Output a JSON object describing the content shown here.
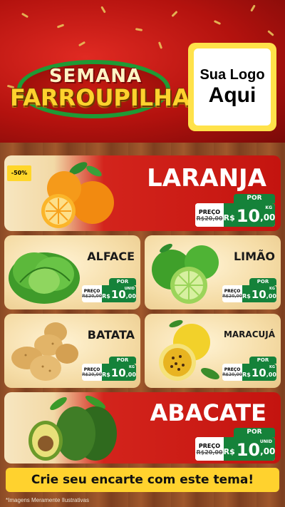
{
  "header": {
    "title_line1": "SEMANA",
    "title_line2": "FARROUPILHA",
    "logo_line1": "Sua Logo",
    "logo_line2": "Aqui",
    "colors": {
      "red": "#c4140f",
      "green": "#15823a",
      "yellow": "#ffd22e"
    }
  },
  "products": [
    {
      "name": "LARANJA",
      "badge": "-50%",
      "por": "POR",
      "preco": "PREÇO",
      "old_price": "R$20,00",
      "currency": "R$",
      "price": "10",
      "cents": ",00",
      "unit": "KG",
      "icon": "orange-icon"
    },
    {
      "name": "ALFACE",
      "por": "POR",
      "preco": "PREÇO",
      "old_price": "R$20,00",
      "currency": "R$",
      "price": "10",
      "cents": ",00",
      "unit": "UNID",
      "icon": "lettuce-icon"
    },
    {
      "name": "LIMÃO",
      "por": "POR",
      "preco": "PREÇO",
      "old_price": "R$20,00",
      "currency": "R$",
      "price": "10",
      "cents": ",00",
      "unit": "KG",
      "icon": "lime-icon"
    },
    {
      "name": "BATATA",
      "por": "POR",
      "preco": "PREÇO",
      "old_price": "R$20,00",
      "currency": "R$",
      "price": "10",
      "cents": ",00",
      "unit": "KG",
      "icon": "potato-icon"
    },
    {
      "name": "MARACUJÁ",
      "por": "POR",
      "preco": "PREÇO",
      "old_price": "R$20,00",
      "currency": "R$",
      "price": "10",
      "cents": ",00",
      "unit": "KG",
      "icon": "passion-fruit-icon"
    },
    {
      "name": "ABACATE",
      "por": "POR",
      "preco": "PREÇO",
      "old_price": "R$20,00",
      "currency": "R$",
      "price": "10",
      "cents": ",00",
      "unit": "UNID",
      "icon": "avocado-icon"
    }
  ],
  "footer": {
    "cta": "Crie seu encarte com este tema!",
    "disclaimer": "*Imagens Meramente Ilustrativas"
  }
}
